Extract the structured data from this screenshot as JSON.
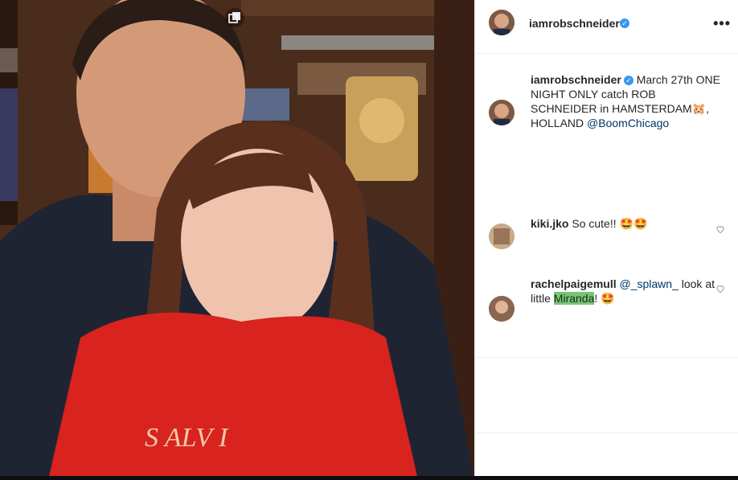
{
  "post": {
    "username": "iamrobschneider",
    "verified_icon": "verified-badge-icon",
    "more_icon": "more-options-icon",
    "caption": {
      "username": "iamrobschneider",
      "text_part1": "March 27th ONE NIGHT ONLY catch ROB SCHNEIDER in HAMSTERDAM",
      "emoji": "🐹",
      "text_part2": ", HOLLAND",
      "mention": "@BoomChicago"
    },
    "comments": [
      {
        "username": "kiki.jko",
        "text": "So cute!! ",
        "emoji": "🤩🤩"
      },
      {
        "username": "rachelpaigemull",
        "mention": "@_splawn_",
        "text_a": " look at little ",
        "highlight": "Miranda",
        "text_b": "! ",
        "emoji": "🤩"
      }
    ]
  },
  "colors": {
    "link": "#003569",
    "verified": "#3897f0",
    "highlight": "#75c772"
  }
}
